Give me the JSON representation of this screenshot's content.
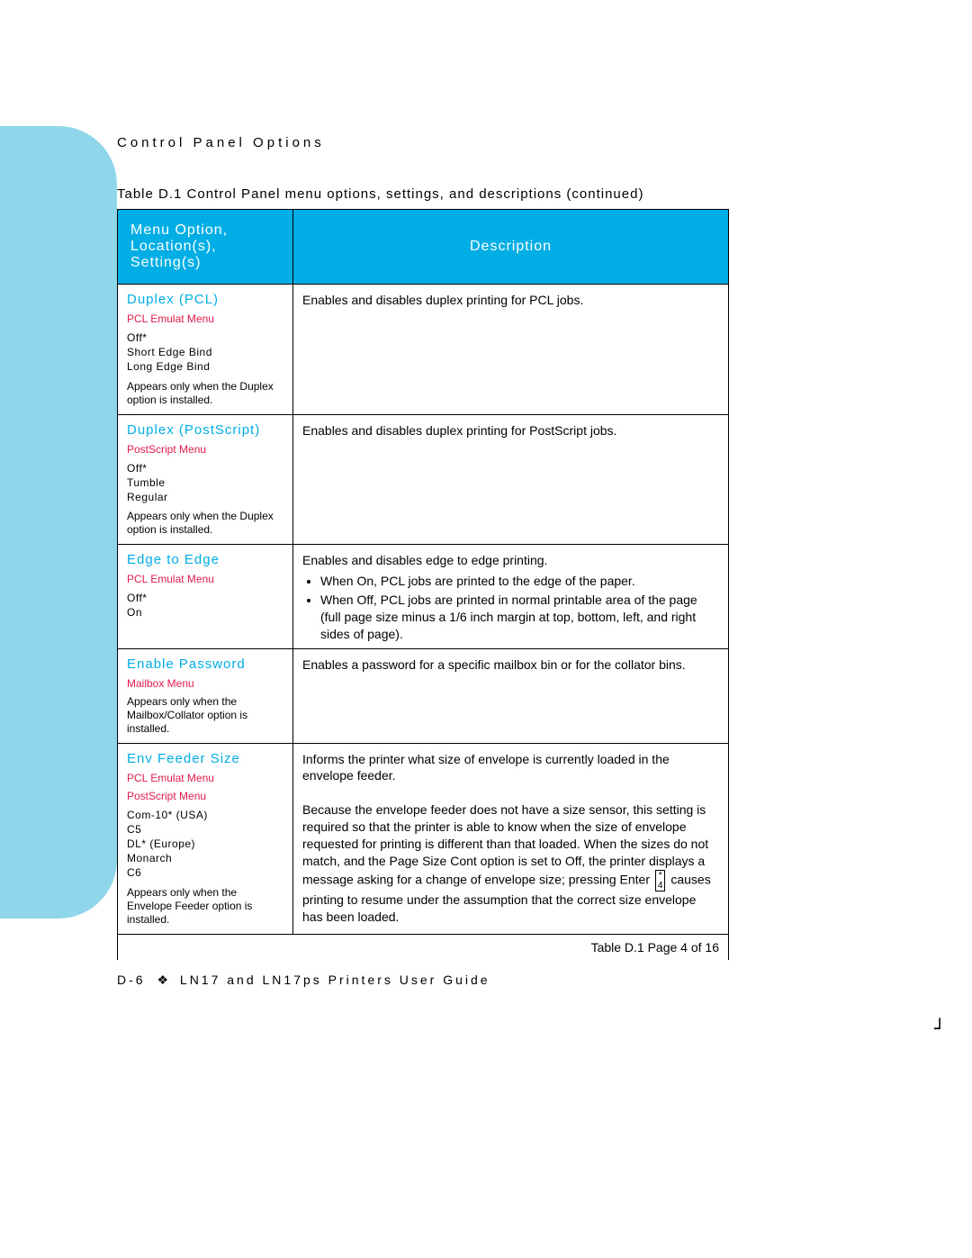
{
  "header": {
    "section": "Control Panel Options",
    "caption": "Table D.1   Control Panel menu options, settings, and descriptions (continued)"
  },
  "table": {
    "head_left": "Menu Option, Location(s), Setting(s)",
    "head_right": "Description",
    "rows": [
      {
        "title": "Duplex (PCL)",
        "menus": [
          "PCL Emulat Menu"
        ],
        "settings": "Off*\nShort Edge Bind\nLong Edge Bind",
        "note": "Appears only when the Duplex option is installed.",
        "desc_html": "Enables and disables duplex printing for PCL jobs."
      },
      {
        "title": "Duplex (PostScript)",
        "menus": [
          "PostScript Menu"
        ],
        "settings": "Off*\nTumble\nRegular",
        "note": "Appears only when the Duplex option is installed.",
        "desc_html": "Enables and disables duplex printing for PostScript jobs."
      },
      {
        "title": "Edge to Edge",
        "menus": [
          "PCL Emulat Menu"
        ],
        "settings": "Off*\nOn",
        "note": "",
        "desc_html": "Enables and disables edge to edge printing.<ul><li>When On, PCL jobs are printed to the edge of the paper.</li><li>When Off, PCL jobs are printed in normal printable area of the page (full page size minus a 1/6 inch margin at top, bottom, left, and right sides of page).</li></ul>"
      },
      {
        "title": "Enable Password",
        "menus": [
          "Mailbox Menu"
        ],
        "settings": "",
        "note": "Appears only when the Mailbox/Collator option is installed.",
        "desc_html": "Enables a password for a specific mailbox bin or for the collator bins."
      },
      {
        "title": "Env Feeder Size",
        "menus": [
          "PCL Emulat Menu",
          "PostScript Menu"
        ],
        "settings": "Com-10* (USA)\nC5\nDL* (Europe)\nMonarch\nC6",
        "note": "Appears only when the Envelope Feeder option is installed.",
        "desc_html": "Informs the printer what size of envelope is currently loaded in the envelope feeder.<br><br>Because the envelope feeder does not have a size sensor, this setting is required so that the printer is able to know when the size of envelope requested for printing is different than that loaded. When the sizes do not match, and the Page Size Cont option is set to Off, the printer displays a message asking for a change of envelope size; pressing <span class='enter-chunk'>Enter <span class='key-block'>*<br>4</span></span> causes printing to resume under the assumption that the correct size envelope has been loaded."
      }
    ],
    "foot": "Table D.1  Page 4 of 16"
  },
  "footer": {
    "page_num": "D-6",
    "guide": "LN17 and LN17ps Printers User Guide"
  }
}
